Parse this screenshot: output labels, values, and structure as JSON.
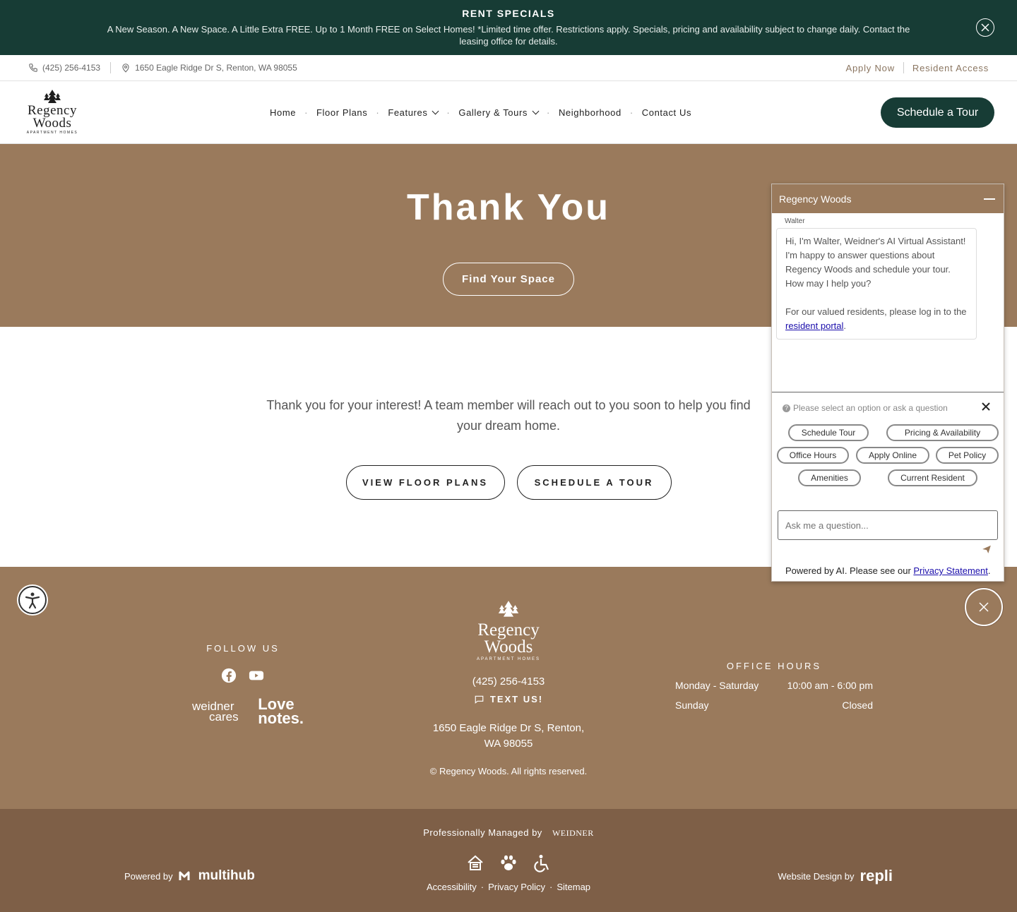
{
  "banner": {
    "title": "RENT SPECIALS",
    "text": "A New Season. A New Space. A Little Extra FREE. Up to 1 Month FREE on Select Homes! *Limited time offer. Restrictions apply. Specials, pricing and availability subject to change daily. Contact the leasing office for details."
  },
  "utility": {
    "phone": "(425) 256-4153",
    "address": "1650 Eagle Ridge Dr S, Renton, WA 98055",
    "apply": "Apply Now",
    "resident": "Resident Access"
  },
  "logo": {
    "line1": "Regency",
    "line2": "Woods",
    "line3": "APARTMENT HOMES"
  },
  "nav": {
    "home": "Home",
    "floor_plans": "Floor Plans",
    "features": "Features",
    "gallery": "Gallery & Tours",
    "neighborhood": "Neighborhood",
    "contact": "Contact Us",
    "cta": "Schedule a Tour"
  },
  "hero": {
    "title": "Thank You",
    "button": "Find Your Space"
  },
  "content": {
    "message": "Thank you for your interest! A team member will reach out to you soon to help you find your dream home.",
    "btn_floor": "VIEW FLOOR PLANS",
    "btn_tour": "SCHEDULE A TOUR"
  },
  "footer": {
    "follow": "FOLLOW US",
    "weidner_cares_1": "weidner",
    "weidner_cares_2": "cares",
    "love_notes_1": "Love",
    "love_notes_2": "notes.",
    "phone": "(425) 256-4153",
    "text_us": "TEXT US!",
    "address_1": "1650 Eagle Ridge Dr S, Renton,",
    "address_2": "WA 98055",
    "copyright": "© Regency Woods. All rights reserved.",
    "hours_title": "OFFICE HOURS",
    "hours": [
      {
        "day": "Monday - Saturday",
        "time": "10:00 am - 6:00 pm"
      },
      {
        "day": "Sunday",
        "time": "Closed"
      }
    ]
  },
  "bottom": {
    "managed": "Professionally Managed by",
    "weidner": "WEIDNER",
    "powered": "Powered by",
    "multihub": "multihub",
    "accessibility": "Accessibility",
    "privacy": "Privacy Policy",
    "sitemap": "Sitemap",
    "design": "Website Design by",
    "repli": "repli"
  },
  "chat": {
    "title": "Regency Woods",
    "sender": "Walter",
    "msg1": "Hi, I'm Walter, Weidner's AI Virtual Assistant! I'm happy to answer questions about Regency Woods and schedule your tour. How may I help you?",
    "msg2_pre": "For our valued residents, please log in to the ",
    "msg2_link": "resident portal",
    "msg2_post": ".",
    "prompt": "Please select an option or ask a question",
    "options": {
      "schedule": "Schedule Tour",
      "pricing": "Pricing & Availability",
      "office": "Office Hours",
      "apply": "Apply Online",
      "pet": "Pet Policy",
      "amenities": "Amenities",
      "resident": "Current Resident"
    },
    "placeholder": "Ask me a question...",
    "foot_pre": "Powered by AI. Please see our ",
    "foot_link": "Privacy Statement",
    "foot_post": "."
  }
}
